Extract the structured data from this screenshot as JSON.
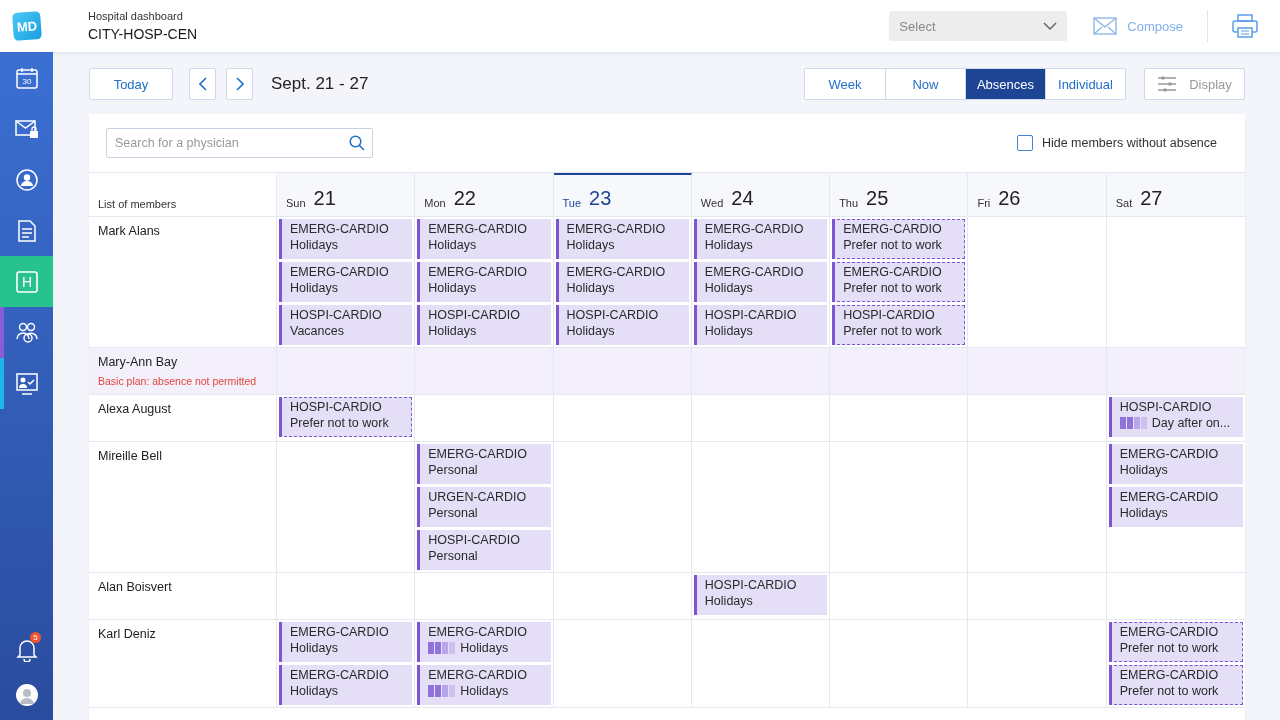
{
  "header": {
    "subtitle": "Hospital dashboard",
    "title": "CITY-HOSP-CEN",
    "logo": "MD",
    "select": {
      "placeholder": "Select"
    },
    "compose": "Compose"
  },
  "sidebar": {
    "items": [
      {
        "text": "30",
        "selected": false
      },
      {
        "selected": false
      },
      {
        "selected": false
      },
      {
        "selected": false
      },
      {
        "text": "H",
        "selected": true
      },
      {
        "selected": false,
        "color": "#8a5cd6"
      },
      {
        "selected": false,
        "color": "#1fb5e8"
      }
    ],
    "notifications": "5"
  },
  "toolbar": {
    "today": "Today",
    "range": "Sept. 21 - 27",
    "views": [
      {
        "label": "Week",
        "selected": false
      },
      {
        "label": "Now",
        "selected": false
      },
      {
        "label": "Absences",
        "selected": true
      },
      {
        "label": "Individual",
        "selected": false
      }
    ],
    "display": "Display"
  },
  "search": {
    "placeholder": "Search for a physician"
  },
  "hide_filter": {
    "label": "Hide members without absence",
    "checked": false
  },
  "table": {
    "members_heading": "List of members",
    "days": [
      {
        "weekday": "Sun",
        "date": "21",
        "selected": false
      },
      {
        "weekday": "Mon",
        "date": "22",
        "selected": false
      },
      {
        "weekday": "Tue",
        "date": "23",
        "selected": true
      },
      {
        "weekday": "Wed",
        "date": "24",
        "selected": false
      },
      {
        "weekday": "Thu",
        "date": "25",
        "selected": false
      },
      {
        "weekday": "Fri",
        "date": "26",
        "selected": false
      },
      {
        "weekday": "Sat",
        "date": "27",
        "selected": false
      }
    ],
    "members": [
      {
        "name": "Mark Alans",
        "restricted": false,
        "days": [
          {
            "shaded": false,
            "entries": [
              {
                "unit": "EMERG-CARDIO",
                "label": "Holidays",
                "kind": "absence",
                "split": false
              },
              {
                "unit": "EMERG-CARDIO",
                "label": "Holidays",
                "kind": "absence",
                "split": false
              },
              {
                "unit": "HOSPI-CARDIO",
                "label": "Vacances",
                "kind": "absence",
                "split": false
              }
            ]
          },
          {
            "shaded": false,
            "entries": [
              {
                "unit": "EMERG-CARDIO",
                "label": "Holidays",
                "kind": "absence",
                "split": false
              },
              {
                "unit": "EMERG-CARDIO",
                "label": "Holidays",
                "kind": "absence",
                "split": false
              },
              {
                "unit": "HOSPI-CARDIO",
                "label": "Holidays",
                "kind": "absence",
                "split": false
              }
            ]
          },
          {
            "shaded": false,
            "entries": [
              {
                "unit": "EMERG-CARDIO",
                "label": "Holidays",
                "kind": "absence",
                "split": false
              },
              {
                "unit": "EMERG-CARDIO",
                "label": "Holidays",
                "kind": "absence",
                "split": false
              },
              {
                "unit": "HOSPI-CARDIO",
                "label": "Holidays",
                "kind": "absence",
                "split": false
              }
            ]
          },
          {
            "shaded": false,
            "entries": [
              {
                "unit": "EMERG-CARDIO",
                "label": "Holidays",
                "kind": "absence",
                "split": false
              },
              {
                "unit": "EMERG-CARDIO",
                "label": "Holidays",
                "kind": "absence",
                "split": false
              },
              {
                "unit": "HOSPI-CARDIO",
                "label": "Holidays",
                "kind": "absence",
                "split": false
              }
            ]
          },
          {
            "shaded": false,
            "entries": [
              {
                "unit": "EMERG-CARDIO",
                "label": "Prefer not to work",
                "kind": "preference",
                "split": false
              },
              {
                "unit": "EMERG-CARDIO",
                "label": "Prefer not to work",
                "kind": "preference",
                "split": false
              },
              {
                "unit": "HOSPI-CARDIO",
                "label": "Prefer not to work",
                "kind": "preference",
                "split": false
              }
            ]
          },
          {
            "shaded": false
          },
          {
            "shaded": false
          }
        ]
      },
      {
        "name": "Mary-Ann Bay",
        "note": "Basic plan: absence not permitted",
        "restricted": true,
        "days": [
          {
            "shaded": true
          },
          {
            "shaded": true
          },
          {
            "shaded": true
          },
          {
            "shaded": true
          },
          {
            "shaded": true
          },
          {
            "shaded": true
          },
          {
            "shaded": true
          }
        ]
      },
      {
        "name": "Alexa August",
        "restricted": false,
        "days": [
          {
            "shaded": false,
            "entries": [
              {
                "unit": "HOSPI-CARDIO",
                "label": "Prefer not to work",
                "kind": "preference",
                "split": false
              }
            ]
          },
          {
            "shaded": false
          },
          {
            "shaded": false
          },
          {
            "shaded": false
          },
          {
            "shaded": false
          },
          {
            "shaded": false
          },
          {
            "shaded": false,
            "entries": [
              {
                "unit": "HOSPI-CARDIO",
                "label": "Day after on...",
                "kind": "absence",
                "split": true
              }
            ]
          }
        ]
      },
      {
        "name": "Mireille Bell",
        "restricted": false,
        "days": [
          {
            "shaded": false
          },
          {
            "shaded": false,
            "entries": [
              {
                "unit": "EMERG-CARDIO",
                "label": "Personal",
                "kind": "absence",
                "split": false
              },
              {
                "unit": "URGEN-CARDIO",
                "label": "Personal",
                "kind": "absence",
                "split": false
              },
              {
                "unit": "HOSPI-CARDIO",
                "label": "Personal",
                "kind": "absence",
                "split": false
              }
            ]
          },
          {
            "shaded": false
          },
          {
            "shaded": false
          },
          {
            "shaded": false
          },
          {
            "shaded": false
          },
          {
            "shaded": false,
            "entries": [
              {
                "unit": "EMERG-CARDIO",
                "label": "Holidays",
                "kind": "absence",
                "split": false
              },
              {
                "unit": "EMERG-CARDIO",
                "label": "Holidays",
                "kind": "absence",
                "split": false
              }
            ]
          }
        ]
      },
      {
        "name": "Alan Boisvert",
        "restricted": false,
        "days": [
          {
            "shaded": false
          },
          {
            "shaded": false
          },
          {
            "shaded": false
          },
          {
            "shaded": false,
            "entries": [
              {
                "unit": "HOSPI-CARDIO",
                "label": "Holidays",
                "kind": "absence",
                "split": false
              }
            ]
          },
          {
            "shaded": false
          },
          {
            "shaded": false
          },
          {
            "shaded": false
          }
        ]
      },
      {
        "name": "Karl Deniz",
        "restricted": false,
        "days": [
          {
            "shaded": false,
            "entries": [
              {
                "unit": "EMERG-CARDIO",
                "label": "Holidays",
                "kind": "absence",
                "split": false
              },
              {
                "unit": "EMERG-CARDIO",
                "label": "Holidays",
                "kind": "absence",
                "split": false
              }
            ]
          },
          {
            "shaded": false,
            "entries": [
              {
                "unit": "EMERG-CARDIO",
                "label": "Holidays",
                "kind": "absence",
                "split": true
              },
              {
                "unit": "EMERG-CARDIO",
                "label": "Holidays",
                "kind": "absence",
                "split": true
              }
            ]
          },
          {
            "shaded": false
          },
          {
            "shaded": false
          },
          {
            "shaded": false
          },
          {
            "shaded": false
          },
          {
            "shaded": false,
            "entries": [
              {
                "unit": "EMERG-CARDIO",
                "label": "Prefer not to work",
                "kind": "preference",
                "split": false
              },
              {
                "unit": "EMERG-CARDIO",
                "label": "Prefer not to work",
                "kind": "preference",
                "split": false
              }
            ]
          }
        ]
      }
    ]
  }
}
